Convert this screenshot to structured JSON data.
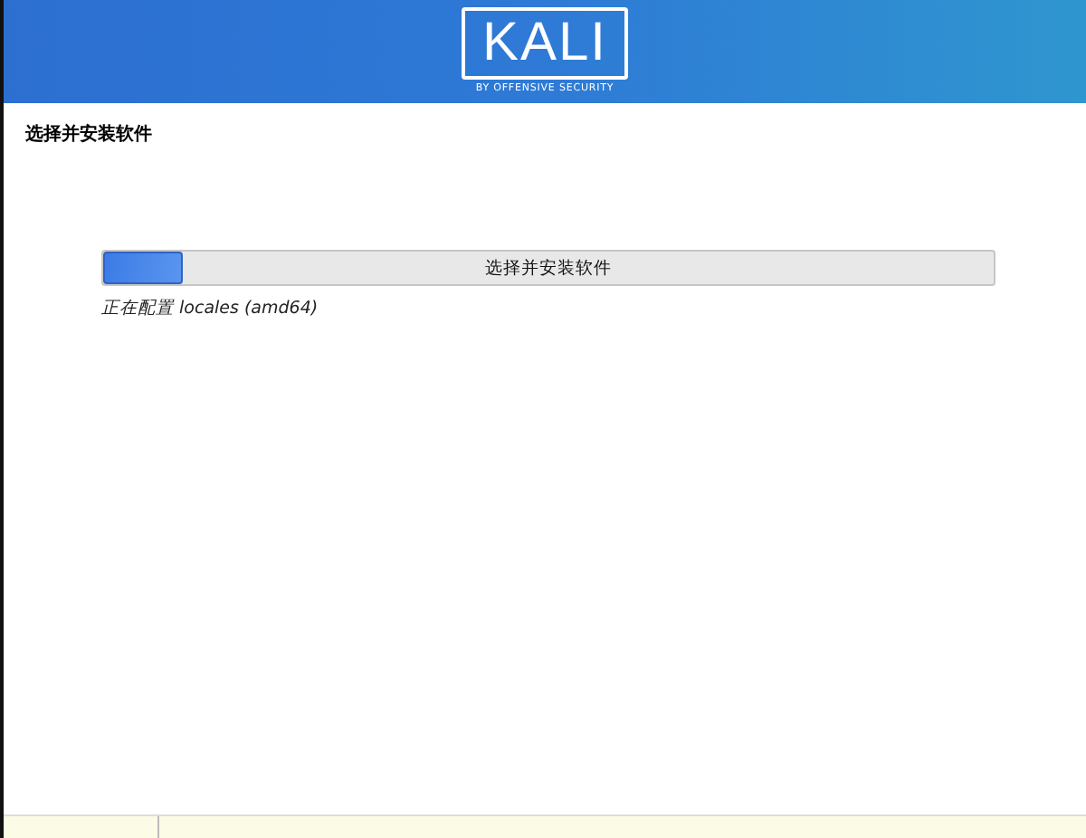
{
  "header": {
    "logo": "KALI",
    "tagline": "BY OFFENSIVE SECURITY"
  },
  "page_title": "选择并安装软件",
  "progress": {
    "label": "选择并安装软件",
    "level": 0.09,
    "status": "正在配置 locales (amd64)"
  }
}
